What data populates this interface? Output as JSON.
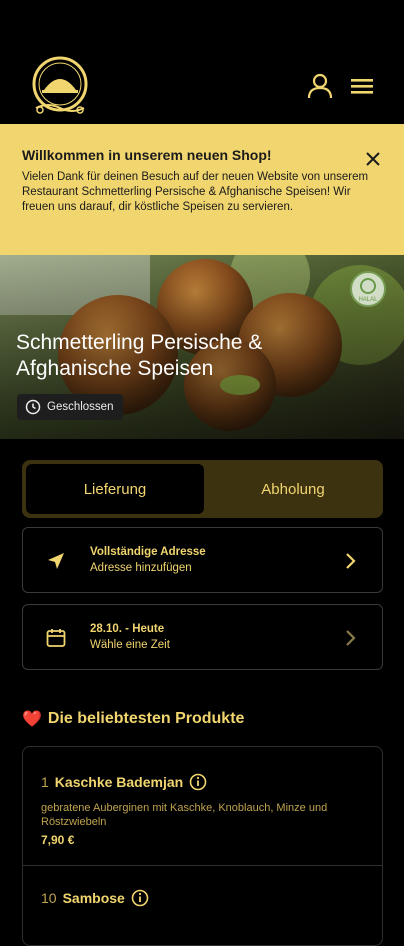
{
  "header": {
    "logo_icon": "restaurant-logo",
    "user_icon": "user-icon",
    "menu_icon": "menu-icon"
  },
  "banner": {
    "title": "Willkommen in unserem neuen Shop!",
    "text": "Vielen Dank für deinen Besuch auf der neuen Website von unserem Restaurant Schmetterling Persische & Afghanische Speisen! Wir freuen uns darauf, dir köstliche Speisen zu servieren."
  },
  "hero": {
    "title": "Schmetterling Persische & Afghanische Speisen",
    "status": "Geschlossen",
    "badge": "HALAL"
  },
  "tabs": {
    "active": "Lieferung",
    "inactive": "Abholung"
  },
  "address": {
    "title": "Vollständige Adresse",
    "subtitle": "Adresse hinzufügen"
  },
  "time": {
    "title": "28.10. - Heute",
    "subtitle": "Wähle eine Zeit"
  },
  "popular": {
    "heart": "❤️",
    "title": "Die beliebtesten Produkte"
  },
  "products": [
    {
      "num": "1",
      "name": "Kaschke Bademjan",
      "desc": "gebratene Auberginen mit Kaschke, Knoblauch, Minze und Röstzwiebeln",
      "price": "7,90 €"
    },
    {
      "num": "10",
      "name": "Sambose",
      "desc": "",
      "price": ""
    }
  ],
  "colors": {
    "accent": "#f1d56f",
    "banner_bg": "#f1d56f",
    "tab_bg": "#3c3210"
  }
}
